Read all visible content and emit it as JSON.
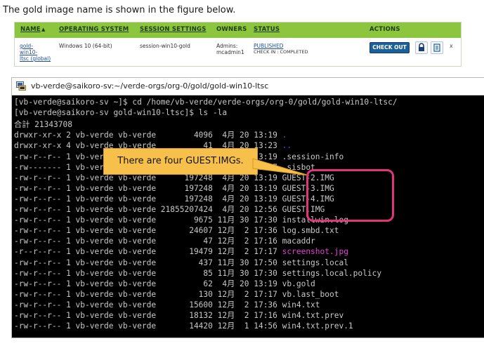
{
  "intro": "The gold image name is shown in the figure below.",
  "table": {
    "headers": {
      "name": "NAME",
      "sort_arrow": "▲",
      "os": "OPERATING SYSTEM",
      "session": "SESSION SETTINGS",
      "owners": "OWNERS",
      "status": "STATUS",
      "actions": "ACTIONS"
    },
    "row": {
      "name_l1": "gold-",
      "name_l2": "win10-",
      "name_l3": "ltsc (global)",
      "os": "Windows 10 (64-bit)",
      "session": "session-win10-gold",
      "owners_l1": "Admins:",
      "owners_l2": "mcadmin1",
      "status_l1": "PUBLISHED",
      "status_l2": "CHECK IN : COMPLETED",
      "checkout": "CHECK OUT",
      "close": "x"
    },
    "header_color": "#8cc63e"
  },
  "window": {
    "title": "vb-verde@saikoro-sv:~/verde-orgs/org-0/gold/gold-win10-ltsc"
  },
  "terminal": [
    {
      "t": "[vb-verde@saikoro-sv ~]$ cd /home/vb-verde/verde-orgs/org-0/gold/gold-win10-ltsc/"
    },
    {
      "t": "[vb-verde@saikoro-sv gold-win10-ltsc]$ ls -la"
    },
    {
      "t": "合計 21343708"
    },
    {
      "t": "drwxr-xr-x 2 vb-verde vb-verde        4096  4月 20 13:19 ",
      "n": ".",
      "c": "blue"
    },
    {
      "t": "drwxr-xr-x 4 vb-verde vb-verde          41  4月 20 13:23 ",
      "n": "..",
      "c": "blue"
    },
    {
      "t": "-rw-r--r-- 1 vb-verde vb-verde          51  4月 20 13:19 .session-info"
    },
    {
      "t": "-rw------- 1 vb-verde vb-verde          41  4月 20 13:17 .sisbot"
    },
    {
      "t": "-rw-r--r-- 1 vb-verde vb-verde      197248  4月 20 13:19 GUEST-2.IMG"
    },
    {
      "t": "-rw-r--r-- 1 vb-verde vb-verde      197248  4月 20 13:19 GUEST-3.IMG"
    },
    {
      "t": "-rw-r--r-- 1 vb-verde vb-verde      197248  4月 20 13:19 GUEST-4.IMG"
    },
    {
      "t": "-rw-r--r-- 1 vb-verde vb-verde 21855207424  4月 20 12:56 GUEST.IMG"
    },
    {
      "t": "-rw-r--r-- 1 vb-verde vb-verde        9675 11月 30 17:30 installwin.log"
    },
    {
      "t": "-rw-r--r-- 1 vb-verde vb-verde       24607 12月  2 17:36 log.smbd.txt"
    },
    {
      "t": "-rw-r--r-- 1 vb-verde vb-verde          47 12月  2 17:16 macaddr"
    },
    {
      "t": "-r--r--r-- 1 vb-verde vb-verde       19479 12月  2 17:17 ",
      "n": "screenshot.jpg",
      "c": "pink"
    },
    {
      "t": "-rw-r--r-- 1 vb-verde vb-verde         437 11月 30 17:50 settings.local"
    },
    {
      "t": "-rw-r--r-- 1 vb-verde vb-verde          85 11月 30 17:30 settings.local.policy"
    },
    {
      "t": "-rw-r--r-- 1 vb-verde vb-verde          62  4月 20 13:19 vb.gold"
    },
    {
      "t": "-rw-r--r-- 1 vb-verde vb-verde         130 12月  2 17:17 vb.last_boot"
    },
    {
      "t": "-rw-r--r-- 1 vb-verde vb-verde       15600 12月  2 17:36 win4.txt"
    },
    {
      "t": "-rw-r--r-- 1 vb-verde vb-verde       18132 12月  2 17:16 win4.txt.prev"
    },
    {
      "t": "-rw-r--r-- 1 vb-verde vb-verde       14420 12月  1 14:56 win4.txt.prev.1"
    }
  ],
  "callout": "There are four GUEST.IMGs.",
  "colors": {
    "terminal_bg": "#000000",
    "terminal_text": "#c8c8c8",
    "dir_blue": "#4a5bd8",
    "image_pink": "#e040d0",
    "highlight": "#e2347a",
    "callout": "#f7c04a",
    "checkout_button": "#1d5f97"
  }
}
